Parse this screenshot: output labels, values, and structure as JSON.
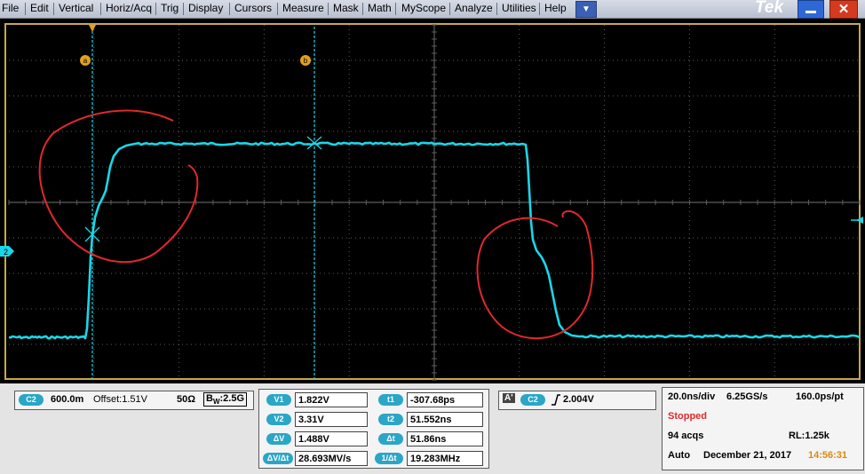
{
  "menu": {
    "items": [
      "File",
      "Edit",
      "Vertical",
      "Horiz/Acq",
      "Trig",
      "Display",
      "Cursors",
      "Measure",
      "Mask",
      "Math",
      "MyScope",
      "Analyze",
      "Utilities",
      "Help"
    ],
    "brand": "Tek"
  },
  "markers": {
    "cursor_a": "a",
    "cursor_b": "b",
    "channel_marker": "2"
  },
  "colors": {
    "trace": "#19d7e8",
    "annotation": "#e0282c",
    "grid": "#5c5c5c",
    "frame": "#c7a84a"
  },
  "channel": {
    "badge": "C2",
    "scale": "600.0m",
    "offset": "Offset:1.51V",
    "impedance": "50Ω",
    "bandwidth_prefix": "B",
    "bandwidth_sub": "W",
    "bandwidth_value": ":2.5G"
  },
  "cursors": {
    "v1": {
      "label": "V1",
      "value": "1.822V"
    },
    "v2": {
      "label": "V2",
      "value": "3.31V"
    },
    "dv": {
      "label": "ΔV",
      "value": "1.488V"
    },
    "dvdt": {
      "label": "ΔV/Δt",
      "value": "28.693MV/s"
    },
    "t1": {
      "label": "t1",
      "value": "-307.68ps"
    },
    "t2": {
      "label": "t2",
      "value": "51.552ns"
    },
    "dt": {
      "label": "Δt",
      "value": "51.86ns"
    },
    "inv_dt": {
      "label": "1/Δt",
      "value": "19.283MHz"
    }
  },
  "trigger": {
    "mode_badge": "A'",
    "source_badge": "C2",
    "slope_icon": "rising-edge-icon",
    "level": "2.004V"
  },
  "acquisition": {
    "timebase": "20.0ns/div",
    "sample_rate": "6.25GS/s",
    "resolution": "160.0ps/pt",
    "state": "Stopped",
    "acqs": "94 acqs",
    "record_length": "RL:1.25k",
    "mode": "Auto",
    "date": "December 21, 2017",
    "time": "14:56:31"
  }
}
